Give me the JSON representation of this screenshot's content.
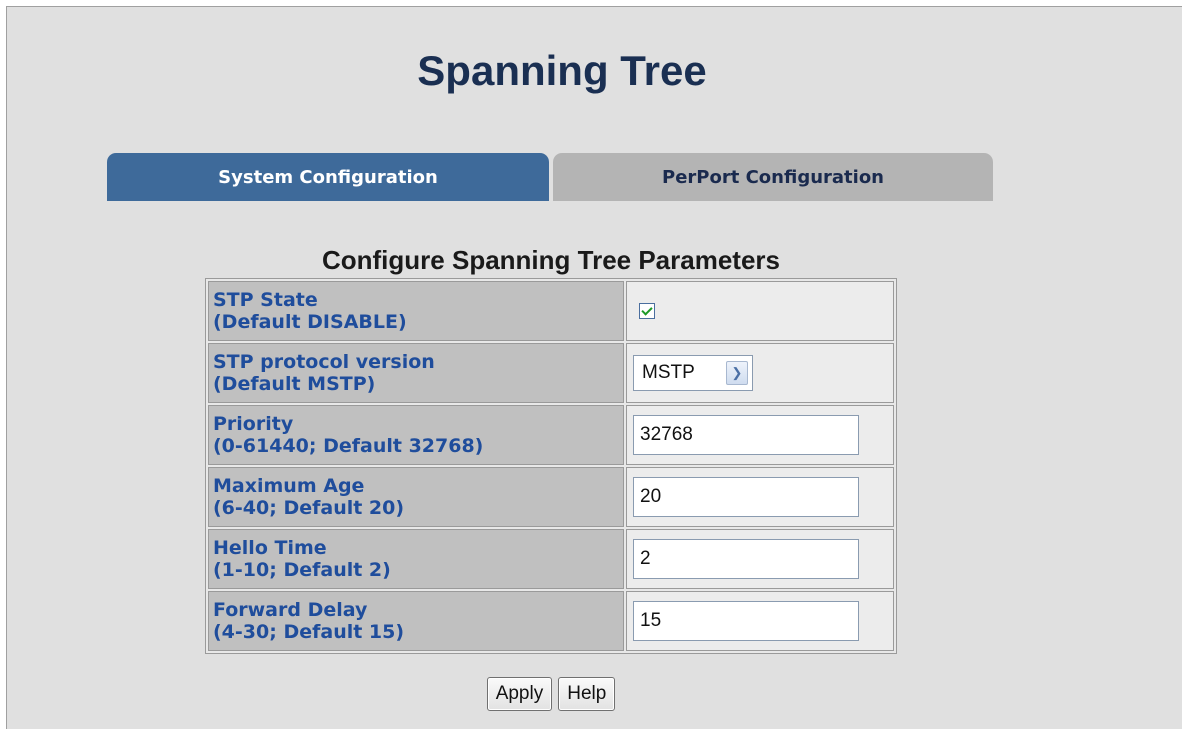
{
  "page": {
    "title": "Spanning Tree"
  },
  "tabs": [
    {
      "label": "System Configuration",
      "active": true
    },
    {
      "label": "PerPort Configuration",
      "active": false
    }
  ],
  "section": {
    "title": "Configure Spanning Tree Parameters"
  },
  "params": {
    "stp_state": {
      "label": "STP State",
      "hint": "(Default DISABLE)",
      "checked": true
    },
    "protocol": {
      "label": "STP protocol version",
      "hint": "(Default MSTP)",
      "value": "MSTP",
      "options": [
        "MSTP"
      ]
    },
    "priority": {
      "label": "Priority",
      "hint": "(0-61440; Default 32768)",
      "value": "32768"
    },
    "max_age": {
      "label": "Maximum Age",
      "hint": "(6-40; Default 20)",
      "value": "20"
    },
    "hello_time": {
      "label": "Hello Time",
      "hint": "(1-10; Default 2)",
      "value": "2"
    },
    "forward_delay": {
      "label": "Forward Delay",
      "hint": "(4-30; Default 15)",
      "value": "15"
    }
  },
  "buttons": {
    "apply": "Apply",
    "help": "Help"
  },
  "colors": {
    "tab_active": "#3e6a9a",
    "tab_inactive": "#b4b4b4",
    "label_text": "#1f4d9c",
    "title_text": "#1a2f52"
  },
  "icons": {
    "select_arrow": "chevron-down-icon",
    "checkbox": "check-icon"
  }
}
